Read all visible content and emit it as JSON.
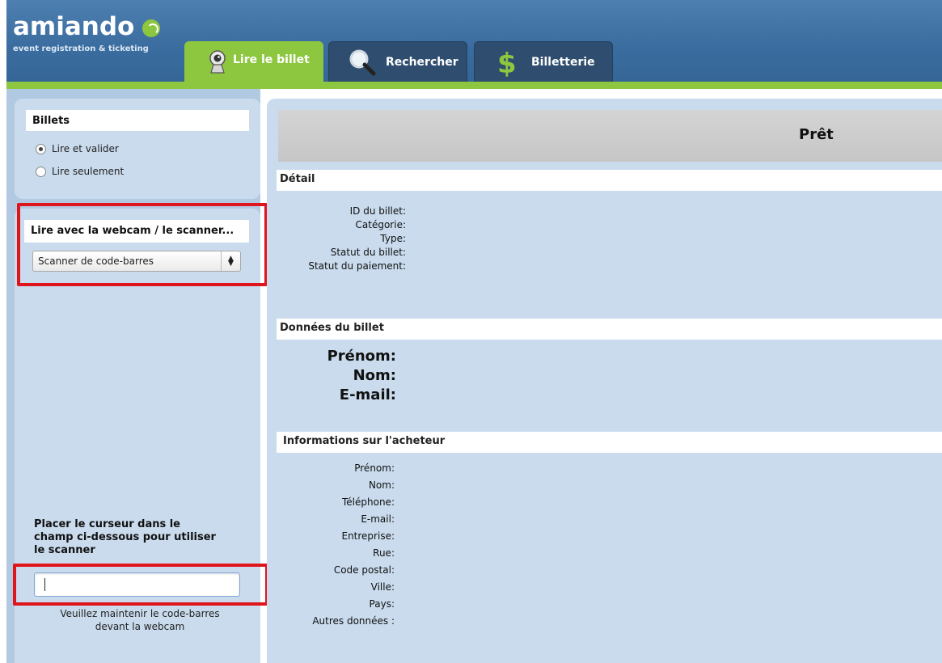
{
  "brand": {
    "name": "amiando",
    "tagline": "event registration & ticketing",
    "accent_color": "#8dc63f",
    "header_color": "#3a6c9f"
  },
  "tabs": [
    {
      "label": "Lire le billet",
      "icon": "webcam-icon",
      "active": true
    },
    {
      "label": "Rechercher",
      "icon": "magnifier-icon",
      "active": false
    },
    {
      "label": "Billetterie",
      "icon": "dollar-icon",
      "active": false
    }
  ],
  "sidebar": {
    "tickets_panel": {
      "title": "Billets",
      "options": [
        {
          "label": "Lire et valider",
          "selected": true
        },
        {
          "label": "Lire seulement",
          "selected": false
        }
      ]
    },
    "device_panel": {
      "title": "Lire avec la webcam / le scanner...",
      "select_value": "Scanner de code-barres"
    },
    "scanner": {
      "instructions": "Placer le curseur dans le champ ci-dessous pour utiliser le scanner",
      "input_value": "",
      "webcam_note": "Veuillez maintenir le code-barres devant la webcam"
    }
  },
  "main": {
    "status": "Prêt",
    "detail": {
      "title": "Détail",
      "labels": [
        "ID du billet:",
        "Catégorie:",
        "Type:",
        "Statut du billet:",
        "Statut du paiement:"
      ]
    },
    "ticket_data": {
      "title": "Données du billet",
      "labels": [
        "Prénom:",
        "Nom:",
        "E-mail:"
      ]
    },
    "buyer_info": {
      "title": "Informations sur l'acheteur",
      "labels": [
        "Prénom:",
        "Nom:",
        "Téléphone:",
        "E-mail:",
        "Entreprise:",
        "Rue:",
        "Code postal:",
        "Ville:",
        "Pays:",
        "Autres données :"
      ]
    }
  }
}
